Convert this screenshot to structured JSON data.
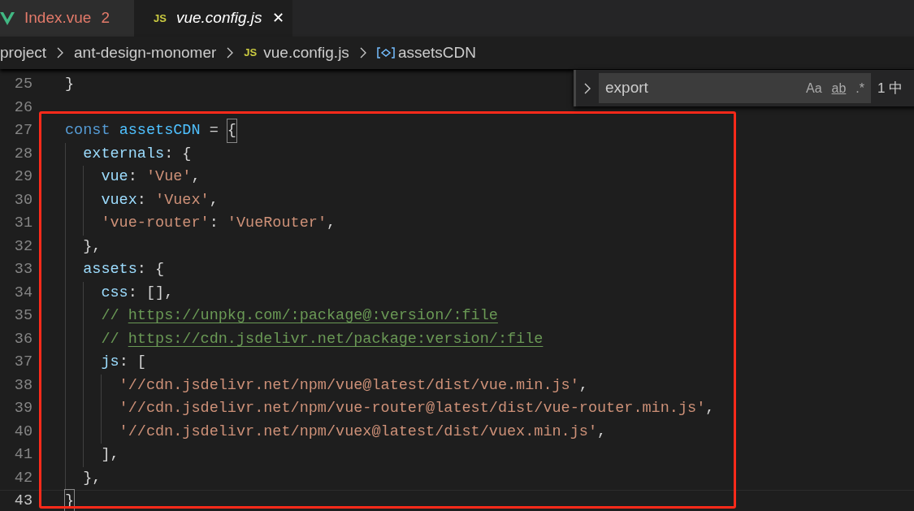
{
  "tabs": [
    {
      "kind": "vue",
      "label": "Index.vue",
      "badge": "2",
      "selected": false,
      "italic": false
    },
    {
      "kind": "js",
      "icon_text": "JS",
      "label": "vue.config.js",
      "close": "✕",
      "selected": true,
      "italic": true
    }
  ],
  "breadcrumb": [
    {
      "kind": "folder",
      "text": "project"
    },
    {
      "kind": "folder",
      "text": "ant-design-monomer"
    },
    {
      "kind": "js",
      "icon_text": "JS",
      "text": "vue.config.js"
    },
    {
      "kind": "symbol",
      "text": "assetsCDN"
    }
  ],
  "find_widget": {
    "value": "export",
    "toggles": [
      "Aa",
      "ab",
      ".*"
    ],
    "result": "1 中"
  },
  "editor": {
    "lines": [
      {
        "number": "25",
        "current": false,
        "tokens": [
          {
            "kind": "punct",
            "text": "}"
          }
        ]
      },
      {
        "number": "26",
        "current": false
      },
      {
        "number": "27",
        "current": false,
        "tokens": [
          {
            "kind": "keyword",
            "text": "const "
          },
          {
            "kind": "variable",
            "text": "assetsCDN"
          },
          {
            "kind": "punct",
            "text": " = "
          },
          {
            "kind": "bracket",
            "text": "{"
          }
        ]
      },
      {
        "number": "28",
        "current": false,
        "tokens": [
          {
            "kind": "property",
            "text": "  externals"
          },
          {
            "kind": "punct",
            "text": ": {"
          }
        ]
      },
      {
        "number": "29",
        "current": false,
        "tokens": [
          {
            "kind": "property",
            "text": "    vue"
          },
          {
            "kind": "punct",
            "text": ": "
          },
          {
            "kind": "string",
            "text": "'Vue'"
          },
          {
            "kind": "punct",
            "text": ","
          }
        ]
      },
      {
        "number": "30",
        "current": false,
        "tokens": [
          {
            "kind": "property",
            "text": "    vuex"
          },
          {
            "kind": "punct",
            "text": ": "
          },
          {
            "kind": "string",
            "text": "'Vuex'"
          },
          {
            "kind": "punct",
            "text": ","
          }
        ]
      },
      {
        "number": "31",
        "current": false,
        "tokens": [
          {
            "kind": "string",
            "text": "    'vue-router'"
          },
          {
            "kind": "punct",
            "text": ": "
          },
          {
            "kind": "string",
            "text": "'VueRouter'"
          },
          {
            "kind": "punct",
            "text": ","
          }
        ]
      },
      {
        "number": "32",
        "current": false,
        "tokens": [
          {
            "kind": "punct",
            "text": "  },"
          }
        ]
      },
      {
        "number": "33",
        "current": false,
        "tokens": [
          {
            "kind": "property",
            "text": "  assets"
          },
          {
            "kind": "punct",
            "text": ": {"
          }
        ]
      },
      {
        "number": "34",
        "current": false,
        "tokens": [
          {
            "kind": "property",
            "text": "    css"
          },
          {
            "kind": "punct",
            "text": ": [],"
          }
        ]
      },
      {
        "number": "35",
        "current": false,
        "tokens": [
          {
            "kind": "comment",
            "text": "    // "
          },
          {
            "kind": "link",
            "text": "https://unpkg.com/:package@:version/:file"
          }
        ]
      },
      {
        "number": "36",
        "current": false,
        "tokens": [
          {
            "kind": "comment",
            "text": "    // "
          },
          {
            "kind": "link",
            "text": "https://cdn.jsdelivr.net/package:version/:file"
          }
        ]
      },
      {
        "number": "37",
        "current": false,
        "tokens": [
          {
            "kind": "property",
            "text": "    js"
          },
          {
            "kind": "punct",
            "text": ": ["
          }
        ]
      },
      {
        "number": "38",
        "current": false,
        "tokens": [
          {
            "kind": "string",
            "text": "      '//cdn.jsdelivr.net/npm/vue@latest/dist/vue.min.js'"
          },
          {
            "kind": "punct",
            "text": ","
          }
        ]
      },
      {
        "number": "39",
        "current": false,
        "tokens": [
          {
            "kind": "string",
            "text": "      '//cdn.jsdelivr.net/npm/vue-router@latest/dist/vue-router.min.js'"
          },
          {
            "kind": "punct",
            "text": ","
          }
        ]
      },
      {
        "number": "40",
        "current": false,
        "tokens": [
          {
            "kind": "string",
            "text": "      '//cdn.jsdelivr.net/npm/vuex@latest/dist/vuex.min.js'"
          },
          {
            "kind": "punct",
            "text": ","
          }
        ]
      },
      {
        "number": "41",
        "current": false,
        "tokens": [
          {
            "kind": "punct",
            "text": "    ],"
          }
        ]
      },
      {
        "number": "42",
        "current": false,
        "tokens": [
          {
            "kind": "punct",
            "text": "  },"
          }
        ]
      },
      {
        "number": "43",
        "current": true,
        "tokens": [
          {
            "kind": "bracket",
            "text": "}"
          }
        ]
      }
    ]
  }
}
